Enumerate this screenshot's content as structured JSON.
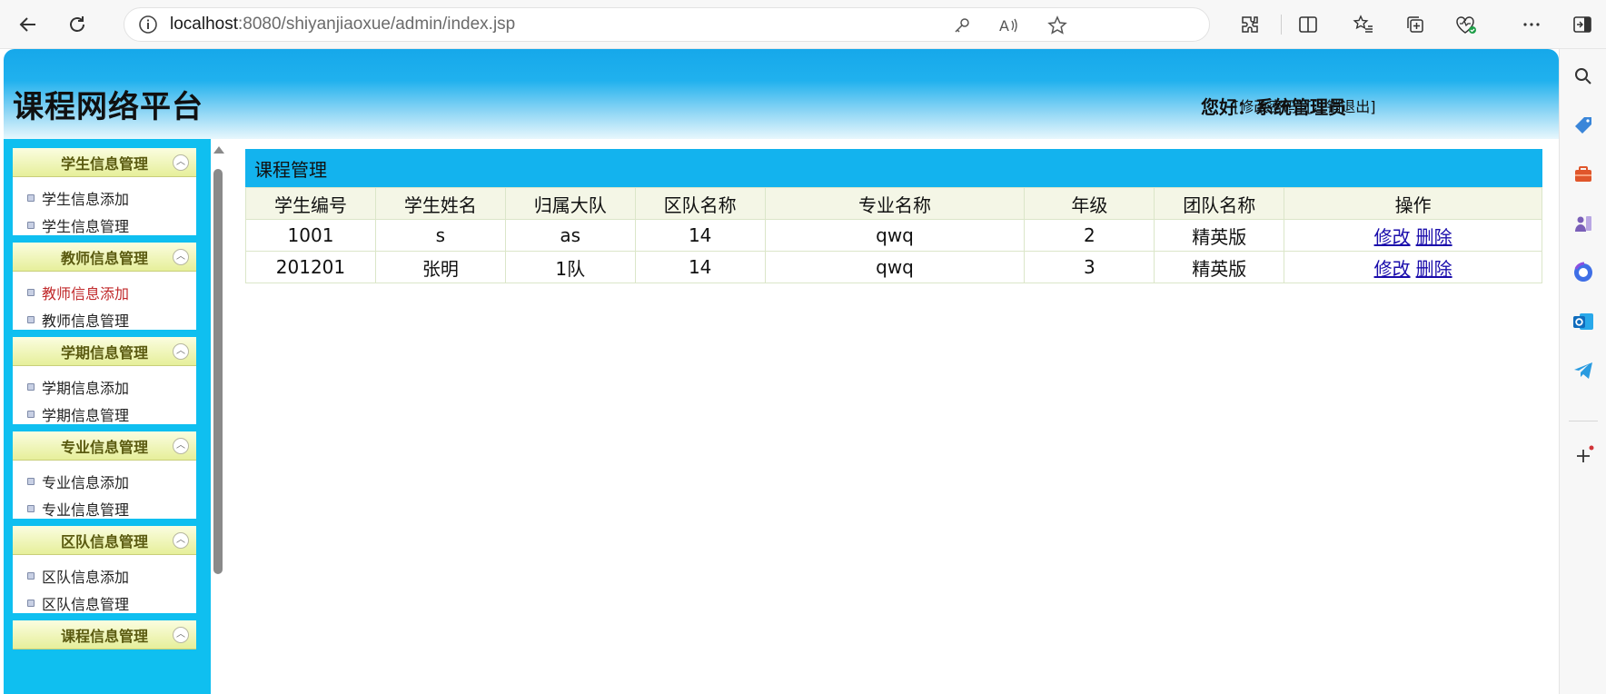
{
  "browser": {
    "url_host": "localhost",
    "url_rest": ":8080/shiyanjiaoxue/admin/index.jsp",
    "icons": [
      "back-arrow-icon",
      "refresh-icon",
      "info-icon",
      "key-icon",
      "read-aloud-icon",
      "favorite-star-icon",
      "extensions-icon",
      "split-screen-icon",
      "favorites-list-icon",
      "collections-icon",
      "browser-essentials-icon",
      "more-options-icon",
      "sidebar-toggle-icon"
    ]
  },
  "edge_sidebar": {
    "icons": [
      "search-icon",
      "shopping-tag-icon",
      "tools-briefcase-icon",
      "games-icon",
      "copilot-icon",
      "outlook-icon",
      "telegram-icon",
      "add-icon"
    ],
    "colors": {
      "shopping": "#3a86d9",
      "tools": "#e0562b",
      "games": "#7a5fb8",
      "copilot": "#3f6fe6",
      "outlook": "#0f6cbd",
      "send": "#2a9be0",
      "notification": "#d13438"
    }
  },
  "header": {
    "logo": "课程网络平台",
    "greeting": "您好：系统管理员",
    "change_password": "修改密码",
    "logout": "注销退出"
  },
  "menu": [
    {
      "title": "学生信息管理",
      "items": [
        {
          "label": "学生信息添加",
          "active": false
        },
        {
          "label": "学生信息管理",
          "active": false
        }
      ]
    },
    {
      "title": "教师信息管理",
      "items": [
        {
          "label": "教师信息添加",
          "active": true
        },
        {
          "label": "教师信息管理",
          "active": false
        }
      ]
    },
    {
      "title": "学期信息管理",
      "items": [
        {
          "label": "学期信息添加",
          "active": false
        },
        {
          "label": "学期信息管理",
          "active": false
        }
      ]
    },
    {
      "title": "专业信息管理",
      "items": [
        {
          "label": "专业信息添加",
          "active": false
        },
        {
          "label": "专业信息管理",
          "active": false
        }
      ]
    },
    {
      "title": "区队信息管理",
      "items": [
        {
          "label": "区队信息添加",
          "active": false
        },
        {
          "label": "区队信息管理",
          "active": false
        }
      ]
    },
    {
      "title": "课程信息管理",
      "items": []
    }
  ],
  "main": {
    "panel_title": "课程管理",
    "columns": [
      "学生编号",
      "学生姓名",
      "归属大队",
      "区队名称",
      "专业名称",
      "年级",
      "团队名称",
      "操作"
    ],
    "rows": [
      {
        "cells": [
          "1001",
          "s",
          "as",
          "14",
          "qwq",
          "2",
          "精英版"
        ],
        "edit": "修改",
        "delete": "删除"
      },
      {
        "cells": [
          "201201",
          "张明",
          "1队",
          "14",
          "qwq",
          "3",
          "精英版"
        ],
        "edit": "修改",
        "delete": "删除"
      }
    ]
  },
  "colors": {
    "header_blue": "#16a8ea",
    "sidebar_blue": "#0fbff0",
    "menu_head": "#e6ef9a",
    "active_link": "#c0282a"
  }
}
